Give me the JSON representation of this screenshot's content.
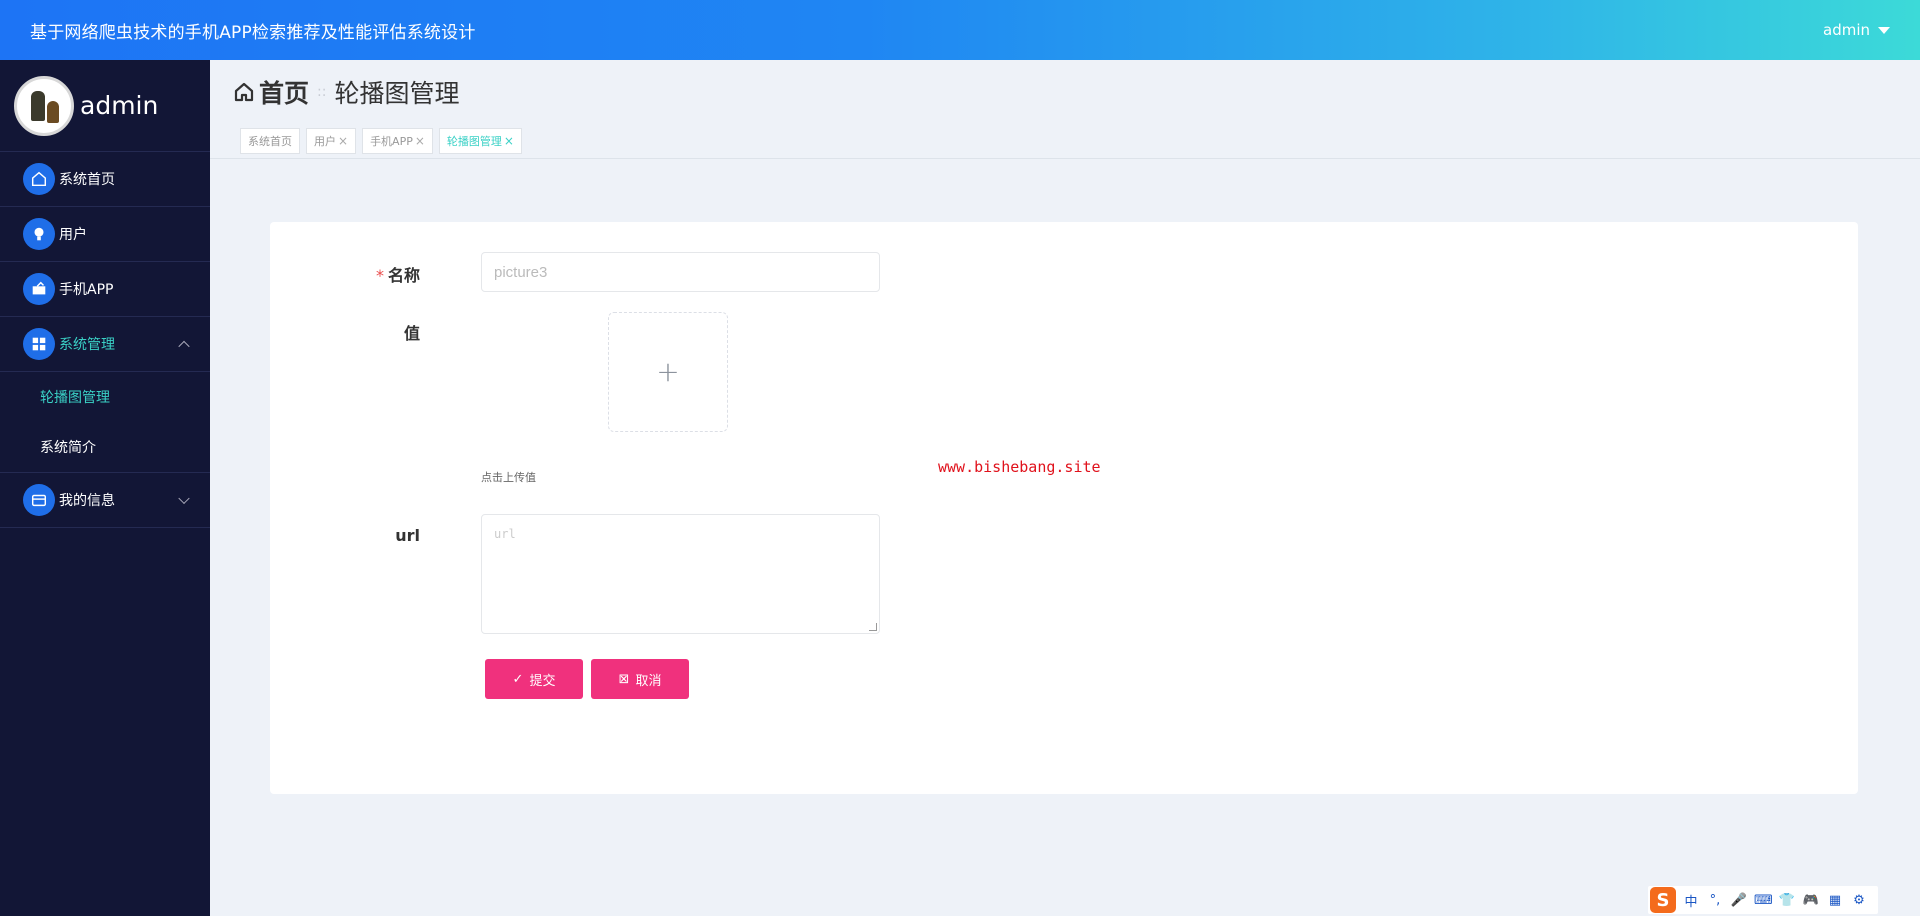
{
  "header": {
    "title": "基于网络爬虫技术的手机APP检索推荐及性能评估系统设计",
    "user_label": "admin"
  },
  "sidebar": {
    "profile_name": "admin",
    "items": [
      {
        "label": "系统首页",
        "icon": "home-icon"
      },
      {
        "label": "用户",
        "icon": "bulb-icon"
      },
      {
        "label": "手机APP",
        "icon": "folder-icon"
      },
      {
        "label": "系统管理",
        "icon": "grid-icon",
        "expanded": true
      },
      {
        "label": "我的信息",
        "icon": "wallet-icon",
        "expanded": false
      }
    ],
    "sub_items": [
      {
        "label": "轮播图管理",
        "active": true
      },
      {
        "label": "系统简介",
        "active": false
      }
    ]
  },
  "breadcrumb": {
    "home": "首页",
    "separator": "::",
    "current": "轮播图管理"
  },
  "tabs": [
    {
      "label": "系统首页",
      "closable": false,
      "active": false
    },
    {
      "label": "用户",
      "closable": true,
      "active": false
    },
    {
      "label": "手机APP",
      "closable": true,
      "active": false
    },
    {
      "label": "轮播图管理",
      "closable": true,
      "active": true
    }
  ],
  "form": {
    "name_label": "名称",
    "name_placeholder": "picture3",
    "value_label": "值",
    "upload_hint": "点击上传值",
    "url_label": "url",
    "url_placeholder": "url",
    "submit_label": "提交",
    "cancel_label": "取消"
  },
  "watermark": "www.bishebang.site",
  "ime": {
    "logo": "S",
    "items": [
      "中",
      "°,",
      "🎤",
      "⌨",
      "👕",
      "🎮",
      "▦",
      "⚙"
    ]
  },
  "colors": {
    "header_start": "#1d74f5",
    "header_end": "#3cdad8",
    "sidebar_bg": "#121636",
    "active_accent": "#3ad1c6",
    "button": "#f0317d"
  }
}
